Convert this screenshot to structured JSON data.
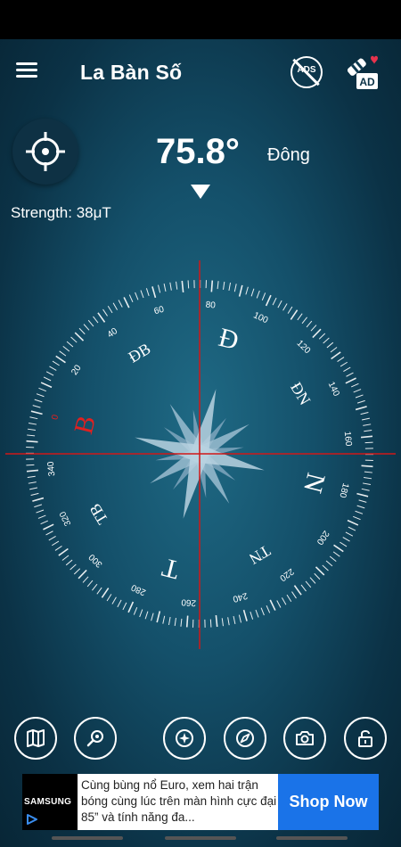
{
  "app": {
    "title": "La Bàn Số"
  },
  "heading": {
    "value": "75.8°",
    "direction": "Đông"
  },
  "strength": {
    "label": "Strength: 38μT"
  },
  "icons": {
    "menu": "hamburger-menu-icon",
    "no_ads": "no-ads-icon",
    "no_ads_label": "ADS",
    "ad_reward": "ad-reward-icon",
    "ad_reward_label": "AD",
    "locate": "crosshair-icon"
  },
  "compass": {
    "cardinals": [
      "B",
      "Đ",
      "N",
      "T"
    ],
    "intercardinals": [
      "ĐB",
      "ĐN",
      "TN",
      "TB"
    ],
    "degree_labels": [
      "0",
      "20",
      "40",
      "60",
      "80",
      "100",
      "120",
      "140",
      "160",
      "180",
      "200",
      "220",
      "240",
      "260",
      "280",
      "300",
      "320",
      "340"
    ],
    "colors": {
      "north": "#e02020",
      "crosshair": "#d01818",
      "text": "#ffffff"
    }
  },
  "toolbar": [
    {
      "name": "map-button",
      "icon": "map-icon"
    },
    {
      "name": "zoom-button",
      "icon": "magnifier-icon"
    },
    {
      "name": "compass-mode-button",
      "icon": "compass-rose-icon"
    },
    {
      "name": "navigation-button",
      "icon": "navigation-compass-icon"
    },
    {
      "name": "camera-button",
      "icon": "camera-icon"
    },
    {
      "name": "lock-button",
      "icon": "unlock-icon"
    }
  ],
  "ad": {
    "brand": "SAMSUNG",
    "text": "Cùng bùng nổ Euro, xem hai trận bóng cùng lúc trên màn hình cực đại 85” và tính năng đa...",
    "cta": "Shop Now",
    "cta_color": "#1a73e8"
  }
}
